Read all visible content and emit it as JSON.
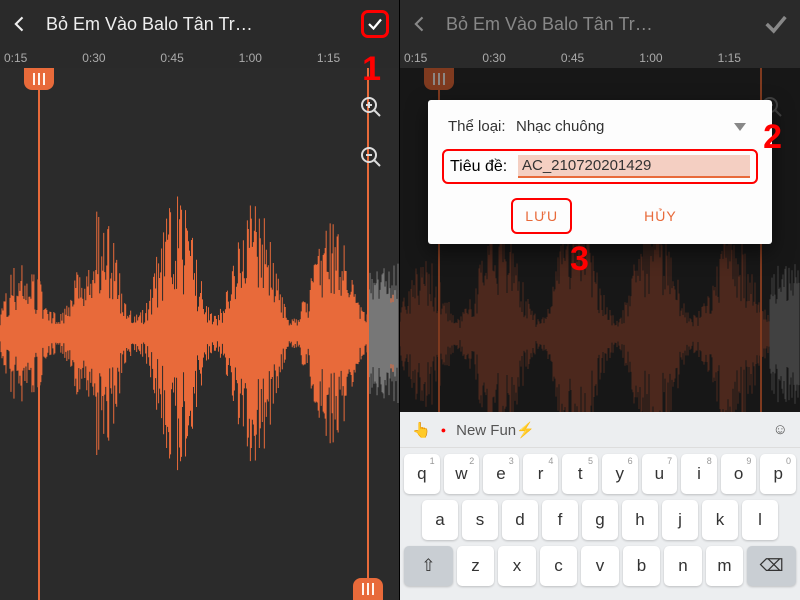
{
  "left": {
    "title": "Bỏ Em Vào Balo  Tân Tr…",
    "ruler": [
      "0:15",
      "0:30",
      "0:45",
      "1:00",
      "1:15"
    ]
  },
  "right": {
    "title": "Bỏ Em Vào Balo  Tân Tr…",
    "ruler": [
      "0:15",
      "0:30",
      "0:45",
      "1:00",
      "1:15"
    ],
    "dialog": {
      "typeLabel": "Thể loại:",
      "typeValue": "Nhạc chuông",
      "titleLabel": "Tiêu đề:",
      "titleValue": "AC_210720201429",
      "save": "LƯU",
      "cancel": "HỦY"
    },
    "keyboard": {
      "suggestion": "New Fun⚡",
      "r1": [
        "q",
        "w",
        "e",
        "r",
        "t",
        "y",
        "u",
        "i",
        "o",
        "p"
      ],
      "nums": [
        "1",
        "2",
        "3",
        "4",
        "5",
        "6",
        "7",
        "8",
        "9",
        "0"
      ],
      "r2": [
        "a",
        "s",
        "d",
        "f",
        "g",
        "h",
        "j",
        "k",
        "l"
      ],
      "r3": [
        "⇧",
        "z",
        "x",
        "c",
        "v",
        "b",
        "n",
        "m",
        "⌫"
      ]
    }
  },
  "annotations": {
    "a1": "1",
    "a2": "2",
    "a3": "3"
  }
}
